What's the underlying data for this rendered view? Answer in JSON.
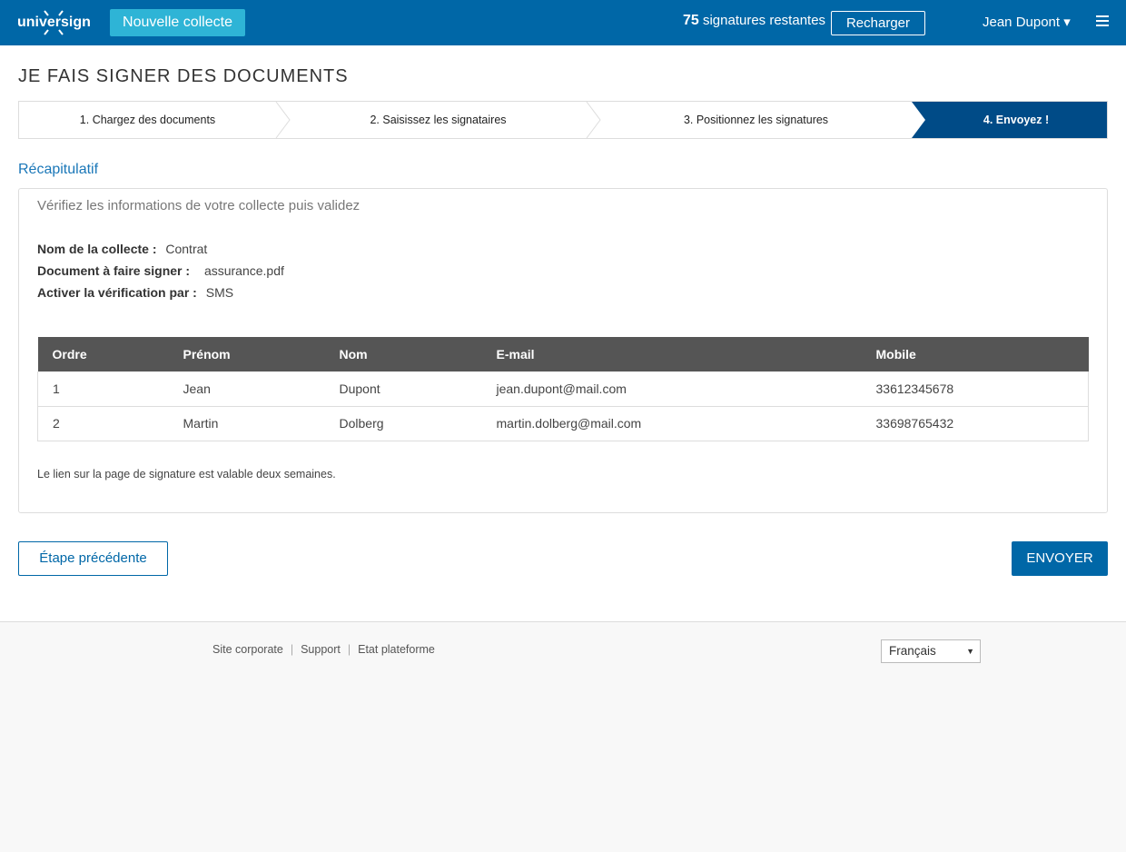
{
  "header": {
    "logo_text": "universign",
    "new_button": "Nouvelle collecte",
    "credits_count": "75",
    "credits_label": "signatures restantes",
    "recharge_button": "Recharger",
    "user_name": "Jean Dupont ▾"
  },
  "page_title": "JE FAIS SIGNER DES DOCUMENTS",
  "steps": [
    {
      "label": "1. Chargez des documents"
    },
    {
      "label": "2. Saisissez les signataires"
    },
    {
      "label": "3. Positionnez les signatures"
    },
    {
      "label": "4. Envoyez !"
    }
  ],
  "active_step": 4,
  "summary": {
    "title": "Récapitulatif",
    "intro": "Vérifiez les informations de votre collecte puis validez",
    "fields": [
      {
        "label": "Nom de la collecte :",
        "value": "Contrat"
      },
      {
        "label": "Document à faire signer :",
        "value": "assurance.pdf"
      },
      {
        "label": "Activer la vérification par :",
        "value": "SMS"
      }
    ],
    "table": {
      "headers": [
        "Ordre",
        "Prénom",
        "Nom",
        "E-mail",
        "Mobile"
      ],
      "rows": [
        [
          "1",
          "Jean",
          "Dupont",
          "jean.dupont@mail.com",
          "33612345678"
        ],
        [
          "2",
          "Martin",
          "Dolberg",
          "martin.dolberg@mail.com",
          "33698765432"
        ]
      ]
    },
    "note": "Le lien sur la page de signature est valable deux semaines."
  },
  "actions": {
    "previous": "Étape précédente",
    "send": "ENVOYER"
  },
  "footer": {
    "links": [
      "Site corporate",
      "Support",
      "Etat plateforme"
    ],
    "language": "Français"
  },
  "colors": {
    "brand": "#0067a7",
    "accent": "#2eb4d6",
    "active_step": "#004b87",
    "table_header": "#555555"
  }
}
